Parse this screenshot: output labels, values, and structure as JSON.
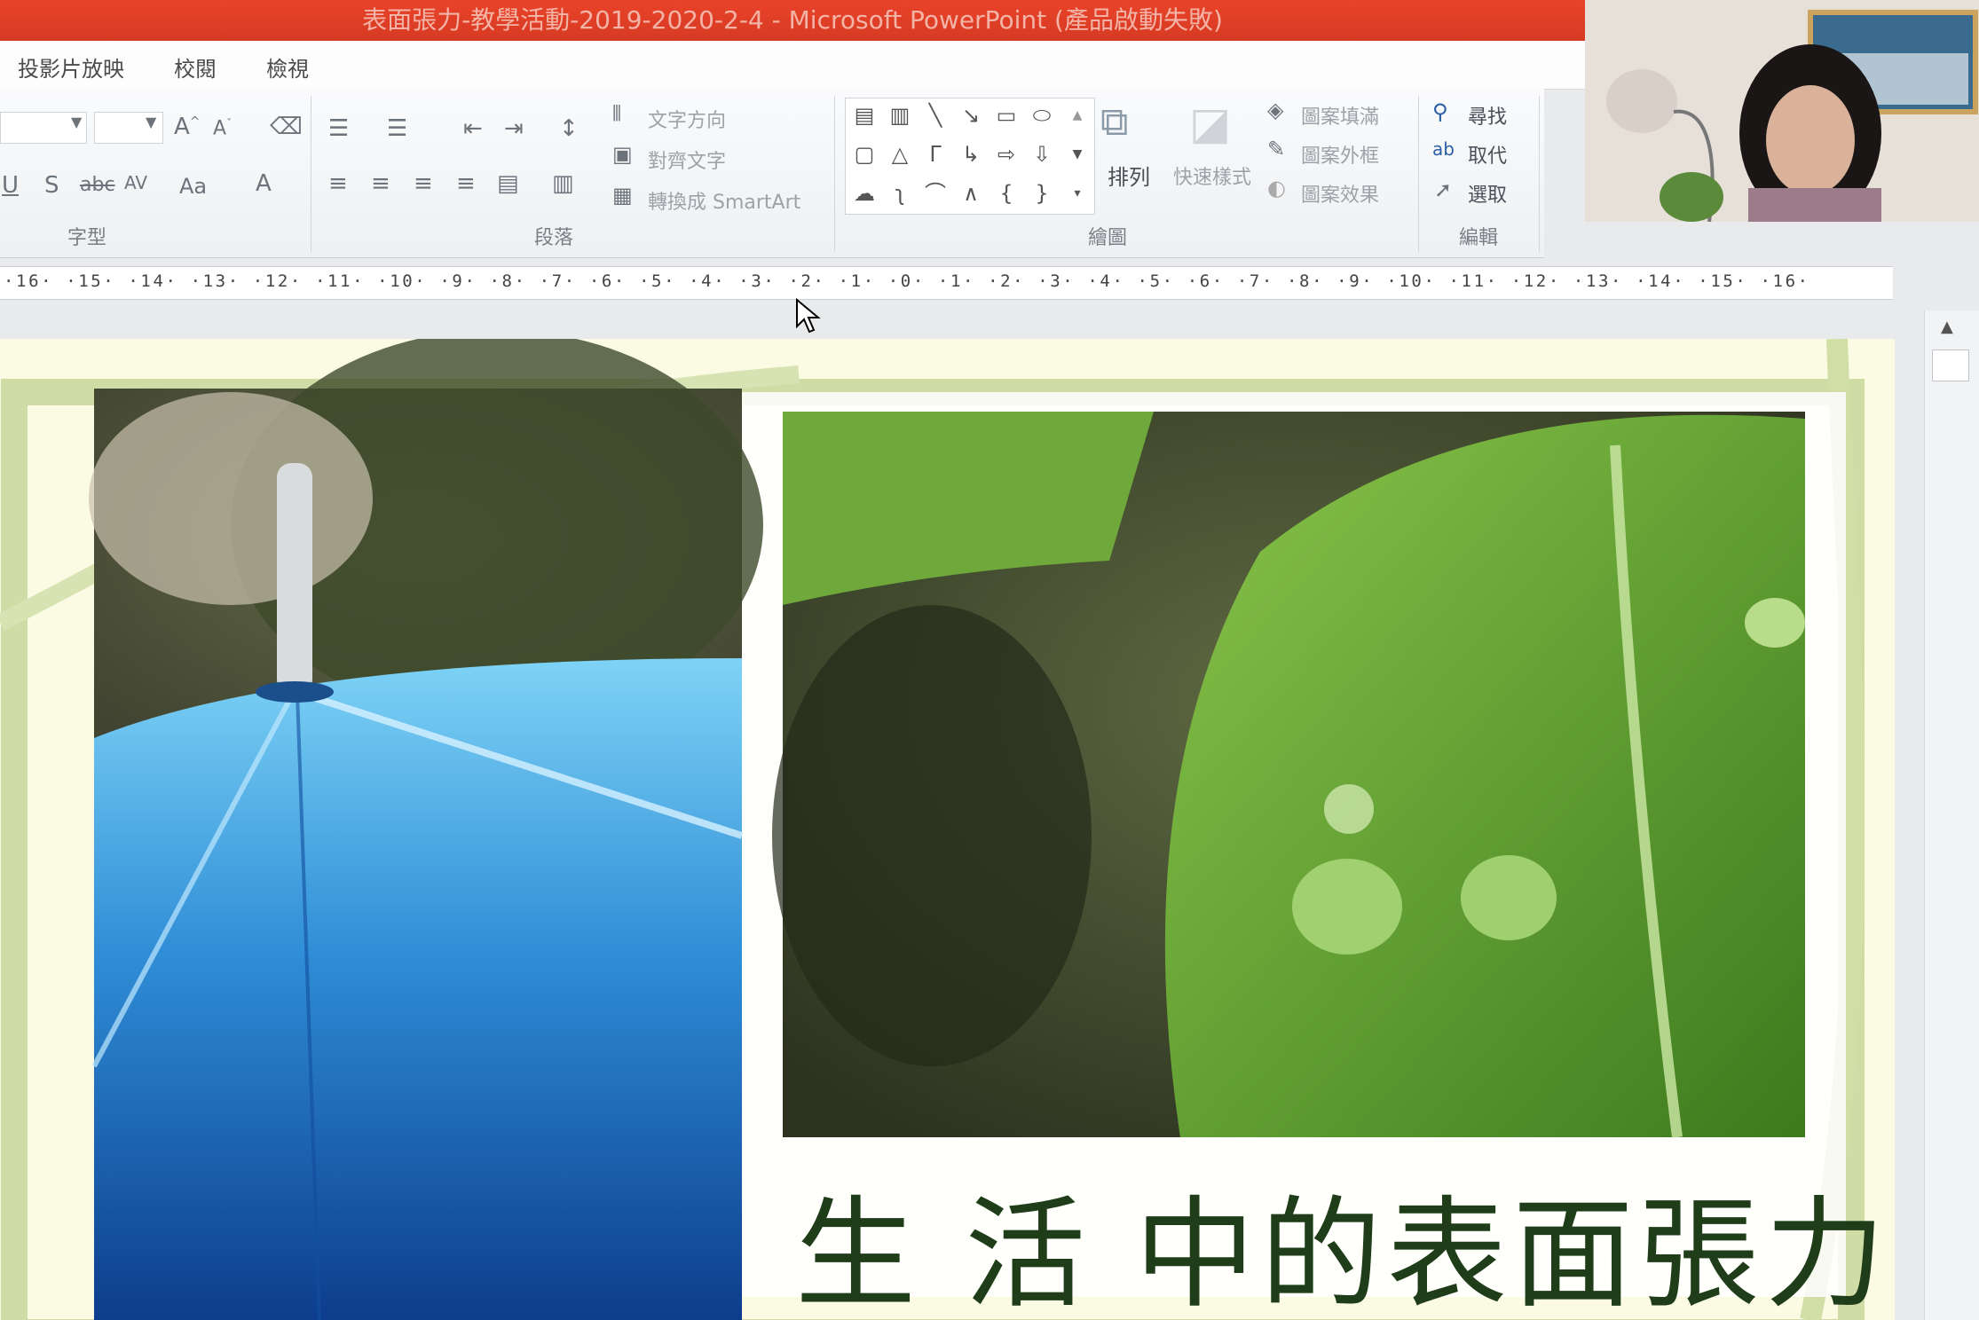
{
  "window": {
    "title": "表面張力-教學活動-2019-2020-2-4 - Microsoft PowerPoint (產品啟動失敗)"
  },
  "menu": {
    "items": [
      "投影片放映",
      "校閱",
      "檢視"
    ]
  },
  "ribbon": {
    "groups": {
      "font": "字型",
      "paragraph": "段落",
      "drawing": "繪圖",
      "editing": "編輯"
    },
    "paragraph": {
      "text_direction": "文字方向",
      "align_text": "對齊文字",
      "convert_smartart": "轉換成 SmartArt"
    },
    "drawing": {
      "arrange": "排列",
      "quick_styles": "快速樣式",
      "shape_fill": "圖案填滿",
      "shape_outline": "圖案外框",
      "shape_effects": "圖案效果"
    },
    "editing": {
      "find": "尋找",
      "replace": "取代",
      "select": "選取"
    }
  },
  "ruler": {
    "text": "·16· ·15· ·14· ·13· ·12· ·11· ·10· ·9· ·8· ·7· ·6· ·5· ·4· ·3· ·2· ·1· ·0· ·1· ·2· ·3· ·4· ·5· ·6· ·7· ·8· ·9· ·10· ·11· ·12· ·13· ·14· ·15· ·16·"
  },
  "slide": {
    "title": "生 活 中的表面張力"
  },
  "colors": {
    "titlebar": "#e23f27",
    "slide_background": "#fbfbe3",
    "slide_title": "#1f3d18",
    "leaf_green": "#5e9a2c",
    "umbrella_blue": "#2f8dd6"
  }
}
